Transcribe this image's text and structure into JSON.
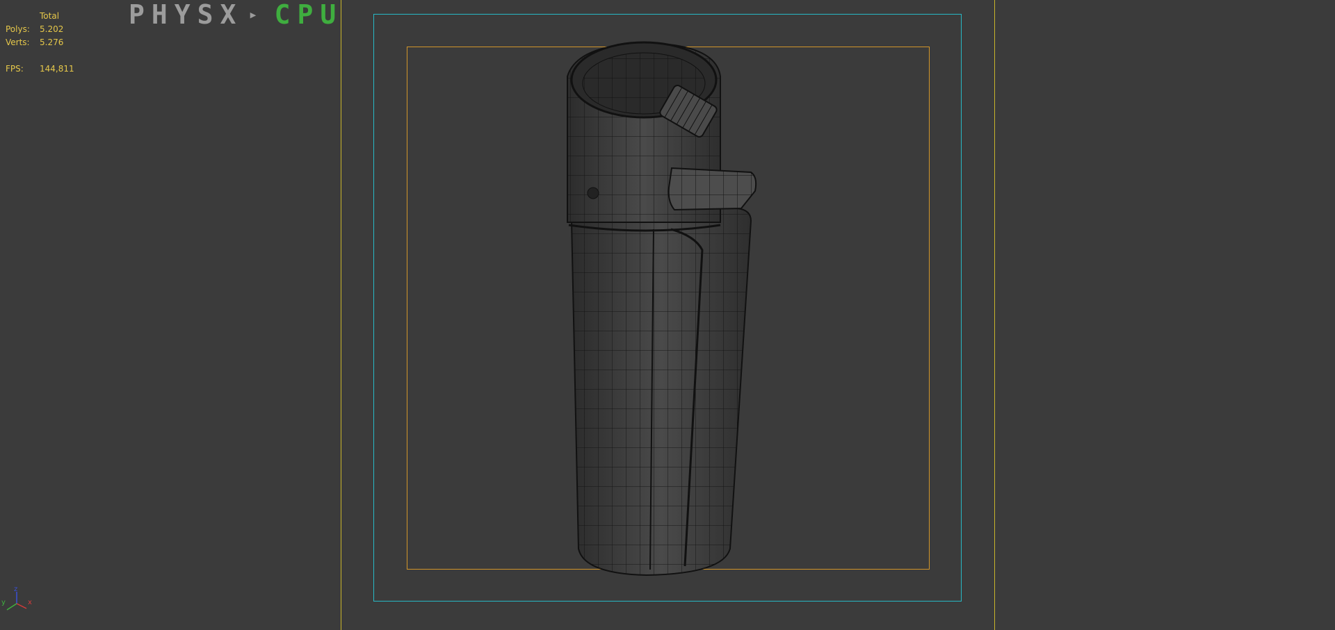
{
  "stats": {
    "total_label": "Total",
    "polys_label": "Polys:",
    "polys_value": "5.202",
    "verts_label": "Verts:",
    "verts_value": "5.276",
    "fps_label": "FPS:",
    "fps_value": "144,811"
  },
  "physx": {
    "word": "PHYSX",
    "mode": "CPU"
  },
  "axis": {
    "x_label": "x",
    "y_label": "y",
    "z_label": "z"
  },
  "colors": {
    "viewport_bg": "#3b3b3b",
    "stats_text": "#e6c84a",
    "safe_frame_outer": "#c9b52a",
    "safe_frame_cyan": "#27b9c6",
    "safe_frame_orange": "#d2962a",
    "physx_green": "#3fae3f"
  }
}
